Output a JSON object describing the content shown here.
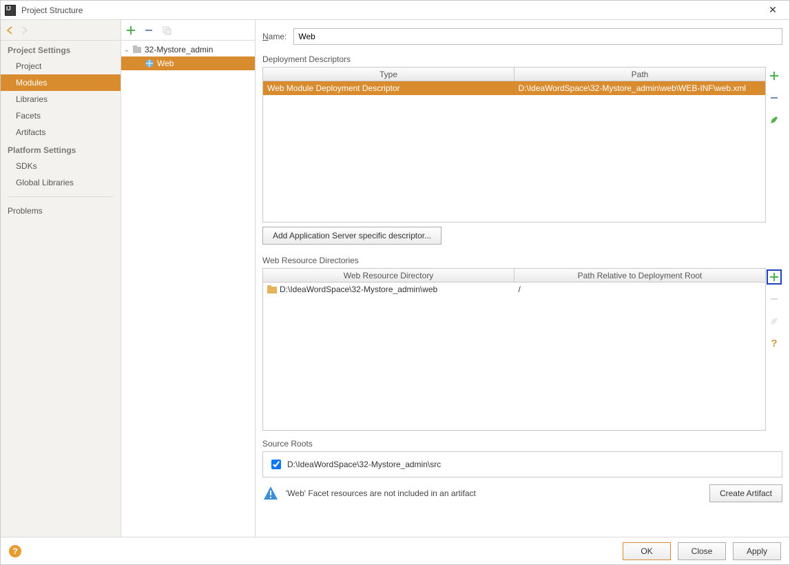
{
  "window": {
    "title": "Project Structure"
  },
  "sidebar": {
    "heading1": "Project Settings",
    "items1": [
      "Project",
      "Modules",
      "Libraries",
      "Facets",
      "Artifacts"
    ],
    "selected1_index": 1,
    "heading2": "Platform Settings",
    "items2": [
      "SDKs",
      "Global Libraries"
    ],
    "problems": "Problems"
  },
  "tree": {
    "root": "32-Mystore_admin",
    "child": "Web"
  },
  "name": {
    "label_pre": "N",
    "label_post": "ame:",
    "value": "Web"
  },
  "descriptors": {
    "section": "Deployment Descriptors",
    "headers": [
      "Type",
      "Path"
    ],
    "row": {
      "type": "Web Module Deployment Descriptor",
      "path": "D:\\IdeaWordSpace\\32-Mystore_admin\\web\\WEB-INF\\web.xml"
    },
    "add_btn": "Add Application Server specific descriptor..."
  },
  "resources": {
    "section": "Web Resource Directories",
    "headers": [
      "Web Resource Directory",
      "Path Relative to Deployment Root"
    ],
    "row": {
      "dir": "D:\\IdeaWordSpace\\32-Mystore_admin\\web",
      "rel": "/"
    }
  },
  "source_roots": {
    "section": "Source Roots",
    "path": "D:\\IdeaWordSpace\\32-Mystore_admin\\src"
  },
  "warning": {
    "msg_pre": "'Web' Facet resources are not included in an artifact",
    "create_btn": "Create Artifact"
  },
  "buttons": {
    "ok": "OK",
    "close": "Close",
    "apply": "Apply"
  }
}
